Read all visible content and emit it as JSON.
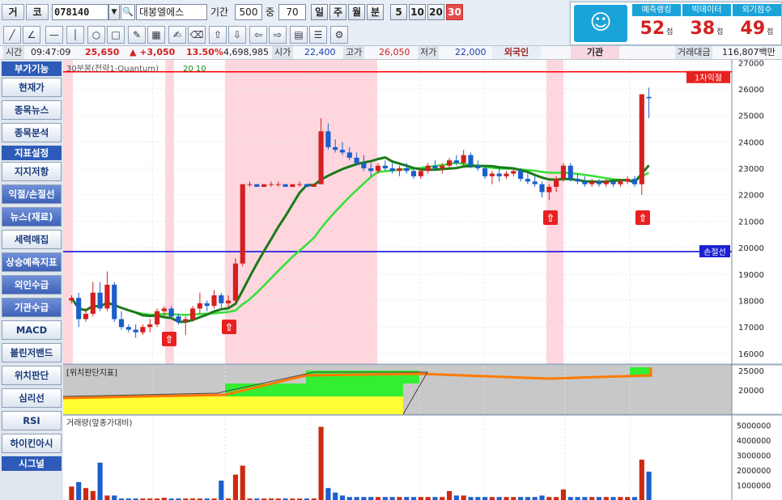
{
  "toolbar": {
    "btn_geo": "거",
    "btn_ko": "코",
    "stock_code": "078140",
    "stock_name": "대봉엘에스",
    "period_label": "기간",
    "period_value": "500",
    "mid_label": "중",
    "mid_value": "70",
    "periods": [
      "일",
      "주",
      "월",
      "분"
    ],
    "minutes": [
      "5",
      "10",
      "20",
      "30"
    ],
    "active_minute": "30"
  },
  "scores": {
    "headers": [
      "예측랭킹",
      "빅데이터",
      "외기점수"
    ],
    "values": [
      "52",
      "38",
      "49"
    ],
    "unit": "점"
  },
  "info": {
    "time_label": "시간",
    "time_value": "09:47:09",
    "price": "25,650",
    "change": "▲ +3,050",
    "change_pct": "13.50%",
    "volume": "4,698,985",
    "open_label": "시가",
    "open_value": "22,400",
    "high_label": "고가",
    "high_value": "26,050",
    "low_label": "저가",
    "low_value": "22,000",
    "foreign_label": "외국인",
    "inst_label": "기관",
    "amount_label": "거래대금",
    "amount_value": "116,807백만"
  },
  "sidebar": {
    "items": [
      {
        "label": "부가기능",
        "kind": "head"
      },
      {
        "label": "현재가",
        "kind": "item"
      },
      {
        "label": "종목뉴스",
        "kind": "item"
      },
      {
        "label": "종목분석",
        "kind": "item"
      },
      {
        "label": "지표설정",
        "kind": "head"
      },
      {
        "label": "지지저항",
        "kind": "item"
      },
      {
        "label": "익절/손절선",
        "kind": "sel"
      },
      {
        "label": "뉴스(재료)",
        "kind": "sel"
      },
      {
        "label": "세력매집",
        "kind": "item"
      },
      {
        "label": "상승예측지표",
        "kind": "sel"
      },
      {
        "label": "외인수급",
        "kind": "sel"
      },
      {
        "label": "기관수급",
        "kind": "sel"
      },
      {
        "label": "MACD",
        "kind": "item"
      },
      {
        "label": "볼린저밴드",
        "kind": "item"
      },
      {
        "label": "위치판단",
        "kind": "item"
      },
      {
        "label": "심리선",
        "kind": "item"
      },
      {
        "label": "RSI",
        "kind": "item"
      },
      {
        "label": "하이킨아시",
        "kind": "item"
      },
      {
        "label": "시그널",
        "kind": "head"
      }
    ]
  },
  "chart_data": {
    "type": "candlestick",
    "title": "30분봉(전략1-Quantum)",
    "legend_values": "20  10",
    "price_axis": [
      "27000",
      "26000",
      "25000",
      "24000",
      "23000",
      "22000",
      "21000",
      "20000",
      "19000",
      "18000",
      "17000",
      "16000"
    ],
    "ylim": [
      15600,
      27100
    ],
    "take_profit": {
      "label": "1차익절",
      "value": 26650
    },
    "stop_loss": {
      "label": "손절선",
      "value": 19850
    },
    "candles": [
      [
        18000,
        18200,
        17900,
        18100
      ],
      [
        18100,
        18300,
        17000,
        17300
      ],
      [
        17300,
        17700,
        17200,
        17500
      ],
      [
        17500,
        18700,
        17400,
        18300
      ],
      [
        18300,
        18700,
        17600,
        17700
      ],
      [
        17700,
        19100,
        17600,
        18600
      ],
      [
        18600,
        18700,
        17200,
        17300
      ],
      [
        17300,
        17600,
        16900,
        17000
      ],
      [
        17000,
        17100,
        16800,
        16900
      ],
      [
        16900,
        17100,
        16600,
        16800
      ],
      [
        16800,
        17100,
        16700,
        17000
      ],
      [
        17000,
        17300,
        16800,
        17100
      ],
      [
        17100,
        17700,
        17000,
        17600
      ],
      [
        17600,
        17800,
        17400,
        17700
      ],
      [
        17700,
        17800,
        17300,
        17400
      ],
      [
        17400,
        17500,
        17100,
        17200
      ],
      [
        17200,
        17400,
        16700,
        17300
      ],
      [
        17300,
        17800,
        17200,
        17700
      ],
      [
        17700,
        18300,
        17500,
        17900
      ],
      [
        17900,
        18000,
        17600,
        17800
      ],
      [
        17800,
        18400,
        17700,
        18200
      ],
      [
        18200,
        18300,
        17700,
        17900
      ],
      [
        17900,
        18200,
        17700,
        18000
      ],
      [
        18000,
        19600,
        17900,
        19400
      ],
      [
        19400,
        22400,
        19300,
        22400
      ],
      [
        22400,
        22500,
        22300,
        22400
      ],
      [
        22400,
        22400,
        22300,
        22300
      ],
      [
        22300,
        22400,
        22300,
        22400
      ],
      [
        22400,
        22500,
        22300,
        22400
      ],
      [
        22400,
        22500,
        22300,
        22400
      ],
      [
        22400,
        22400,
        22300,
        22300
      ],
      [
        22300,
        22400,
        22300,
        22400
      ],
      [
        22400,
        22500,
        22300,
        22400
      ],
      [
        22400,
        22400,
        22300,
        22300
      ],
      [
        22300,
        22400,
        22300,
        22400
      ],
      [
        22400,
        24900,
        22400,
        24400
      ],
      [
        24400,
        24700,
        23700,
        23800
      ],
      [
        23800,
        24100,
        23600,
        23700
      ],
      [
        23700,
        24000,
        23500,
        23600
      ],
      [
        23600,
        23800,
        23300,
        23400
      ],
      [
        23400,
        23600,
        23100,
        23200
      ],
      [
        23200,
        23500,
        22900,
        23000
      ],
      [
        23000,
        23200,
        22700,
        22900
      ],
      [
        22900,
        23200,
        22800,
        23100
      ],
      [
        23100,
        23300,
        22900,
        23000
      ],
      [
        23000,
        23200,
        22800,
        22900
      ],
      [
        22900,
        23100,
        22700,
        23000
      ],
      [
        23000,
        23200,
        22800,
        22900
      ],
      [
        22900,
        23000,
        22600,
        22700
      ],
      [
        22700,
        23000,
        22600,
        22900
      ],
      [
        22900,
        23200,
        22800,
        23100
      ],
      [
        23100,
        23300,
        22900,
        23000
      ],
      [
        23000,
        23200,
        22800,
        23100
      ],
      [
        23100,
        23400,
        23000,
        23300
      ],
      [
        23300,
        23500,
        23100,
        23200
      ],
      [
        23200,
        23700,
        23100,
        23500
      ],
      [
        23500,
        23600,
        23000,
        23100
      ],
      [
        23100,
        23300,
        22900,
        23000
      ],
      [
        23000,
        23100,
        22600,
        22700
      ],
      [
        22700,
        22900,
        22400,
        22800
      ],
      [
        22800,
        23000,
        22500,
        22700
      ],
      [
        22700,
        22900,
        22600,
        22800
      ],
      [
        22800,
        23000,
        22700,
        22900
      ],
      [
        22900,
        23000,
        22500,
        22600
      ],
      [
        22600,
        22800,
        22400,
        22500
      ],
      [
        22500,
        22700,
        22300,
        22400
      ],
      [
        22400,
        22500,
        21900,
        22100
      ],
      [
        22100,
        22400,
        21800,
        22300
      ],
      [
        22300,
        22700,
        22100,
        22600
      ],
      [
        22600,
        23200,
        22500,
        23100
      ],
      [
        23100,
        23200,
        22500,
        22600
      ],
      [
        22600,
        22800,
        22400,
        22500
      ],
      [
        22500,
        22700,
        22300,
        22400
      ],
      [
        22400,
        22600,
        22300,
        22500
      ],
      [
        22500,
        22600,
        22300,
        22400
      ],
      [
        22400,
        22600,
        22300,
        22500
      ],
      [
        22500,
        22600,
        22300,
        22400
      ],
      [
        22400,
        22600,
        22300,
        22500
      ],
      [
        22500,
        22700,
        22400,
        22600
      ],
      [
        22600,
        22700,
        22300,
        22400
      ],
      [
        22400,
        25800,
        22000,
        25800
      ],
      [
        25700,
        26050,
        24900,
        25650
      ]
    ],
    "volume_axis": [
      "5000000",
      "4000000",
      "3000000",
      "2000000",
      "1000000"
    ],
    "vol_title": "거래량(앞종가대비)",
    "pos_title": "[위치판단지표]",
    "pos_axis": [
      "25000",
      "20000"
    ]
  }
}
